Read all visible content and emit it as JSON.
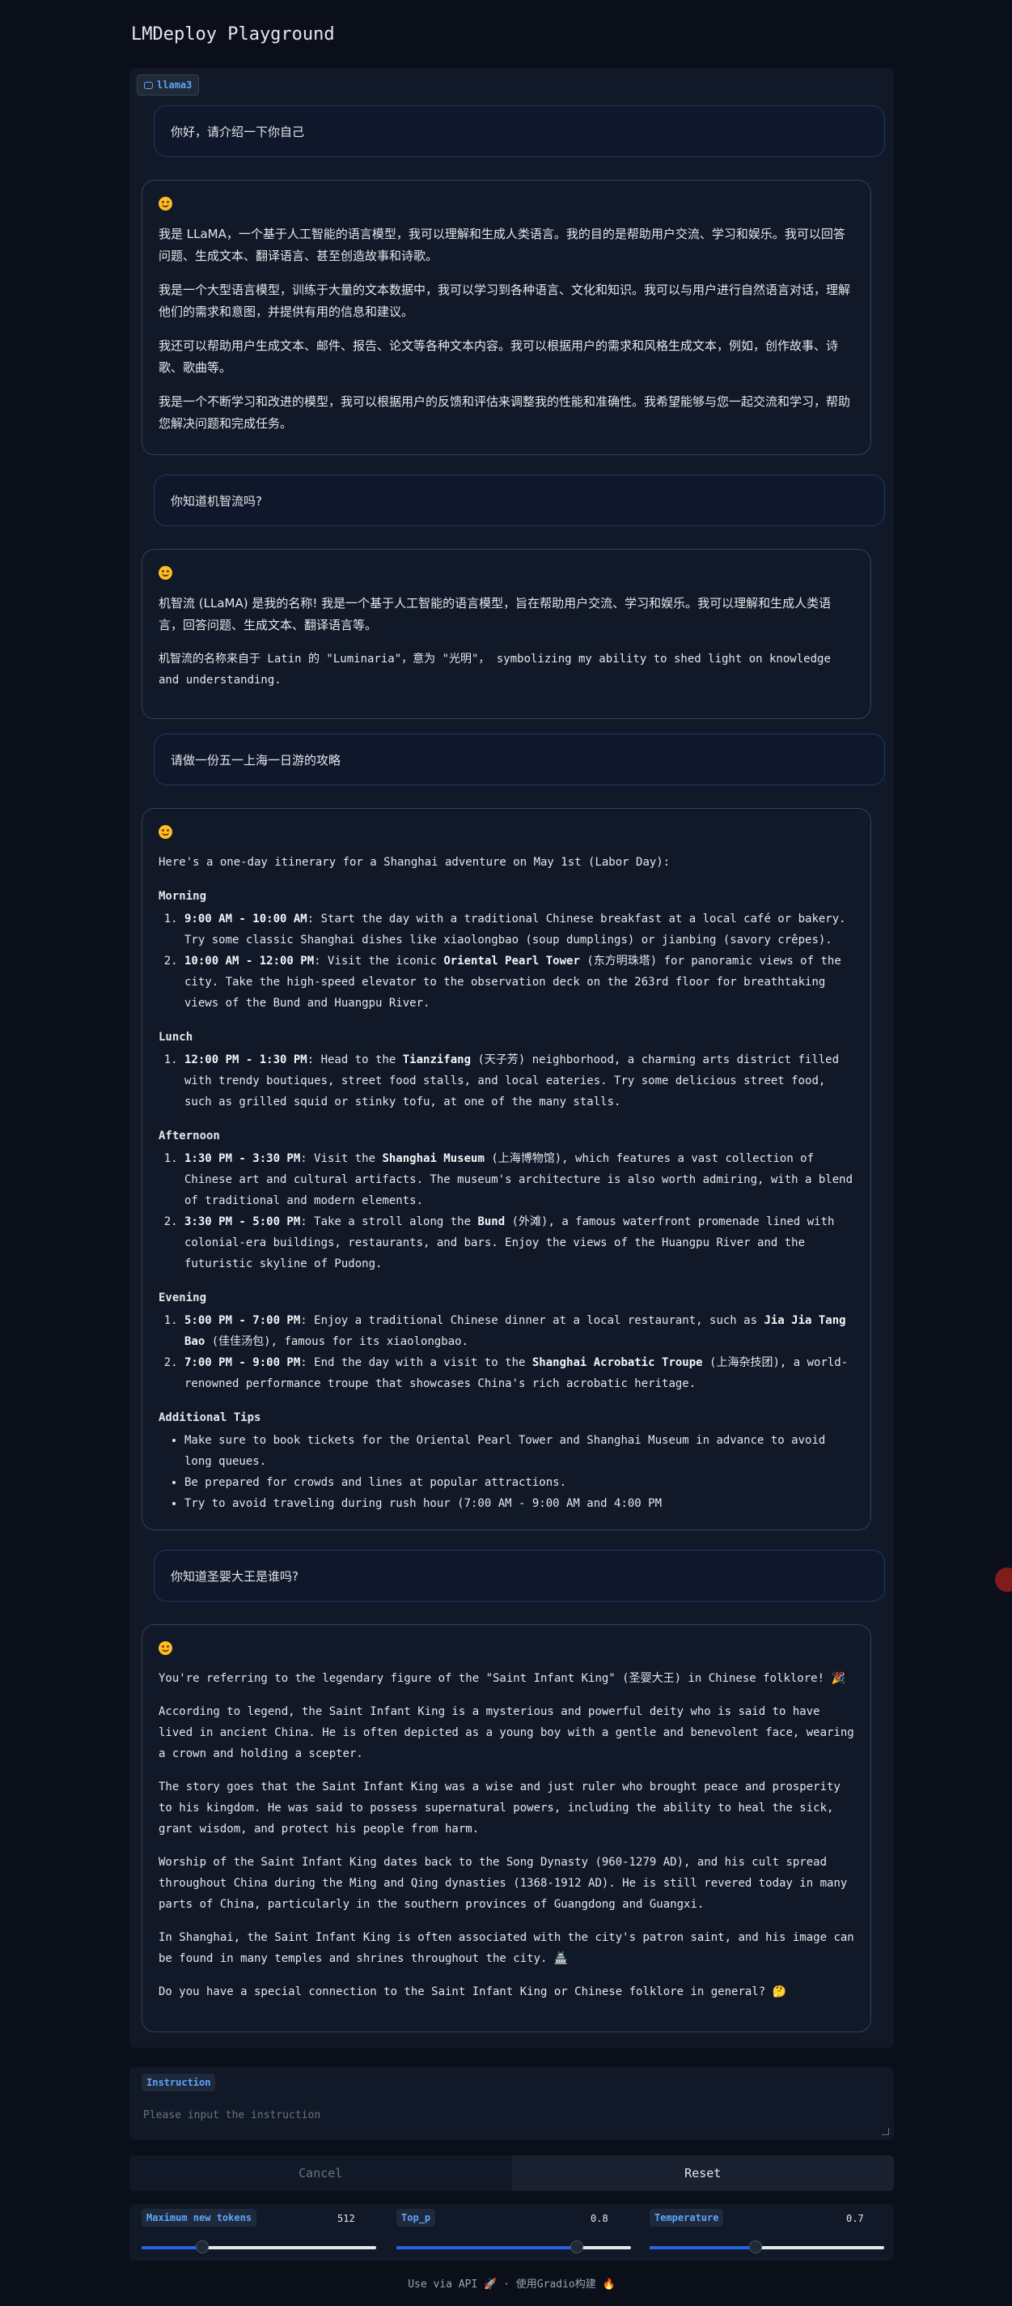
{
  "app": {
    "title": "LMDeploy Playground"
  },
  "chat": {
    "model_name": "llama3",
    "messages": [
      {
        "role": "user",
        "text": "你好，请介绍一下你自己"
      },
      {
        "role": "assistant",
        "paragraphs": [
          "我是 LLaMA，一个基于人工智能的语言模型，我可以理解和生成人类语言。我的目的是帮助用户交流、学习和娱乐。我可以回答问题、生成文本、翻译语言、甚至创造故事和诗歌。",
          "我是一个大型语言模型，训练于大量的文本数据中，我可以学习到各种语言、文化和知识。我可以与用户进行自然语言对话，理解他们的需求和意图，并提供有用的信息和建议。",
          "我还可以帮助用户生成文本、邮件、报告、论文等各种文本内容。我可以根据用户的需求和风格生成文本，例如，创作故事、诗歌、歌曲等。",
          "我是一个不断学习和改进的模型，我可以根据用户的反馈和评估来调整我的性能和准确性。我希望能够与您一起交流和学习，帮助您解决问题和完成任务。"
        ]
      },
      {
        "role": "user",
        "text": "你知道机智流吗?"
      },
      {
        "role": "assistant",
        "paragraphs": [
          "机智流 (LLaMA) 是我的名称! 我是一个基于人工智能的语言模型，旨在帮助用户交流、学习和娱乐。我可以理解和生成人类语言，回答问题、生成文本、翻译语言等。",
          "机智流的名称来自于 Latin 的 \"Luminaria\"，意为 \"光明\"， symbolizing my ability to shed light on knowledge and understanding."
        ]
      },
      {
        "role": "user",
        "text": "请做一份五一上海一日游的攻略"
      },
      {
        "role": "assistant",
        "intro": "Here's a one-day itinerary for a Shanghai adventure on May 1st (Labor Day):",
        "sections": [
          {
            "heading": "Morning",
            "items": [
              {
                "time": "9:00 AM - 10:00 AM",
                "text": ": Start the day with a traditional Chinese breakfast at a local café or bakery. Try some classic Shanghai dishes like xiaolongbao (soup dumplings) or jianbing (savory crêpes)."
              },
              {
                "time": "10:00 AM - 12:00 PM",
                "text_a": ": Visit the iconic ",
                "place": "Oriental Pearl Tower",
                "text_b": " (东方明珠塔) for panoramic views of the city. Take the high-speed elevator to the observation deck on the 263rd floor for breathtaking views of the Bund and Huangpu River."
              }
            ]
          },
          {
            "heading": "Lunch",
            "items": [
              {
                "time": "12:00 PM - 1:30 PM",
                "text_a": ": Head to the ",
                "place": "Tianzifang",
                "text_b": " (天子芳) neighborhood, a charming arts district filled with trendy boutiques, street food stalls, and local eateries. Try some delicious street food, such as grilled squid or stinky tofu, at one of the many stalls."
              }
            ]
          },
          {
            "heading": "Afternoon",
            "items": [
              {
                "time": "1:30 PM - 3:30 PM",
                "text_a": ": Visit the ",
                "place": "Shanghai Museum",
                "text_b": " (上海博物馆), which features a vast collection of Chinese art and cultural artifacts. The museum's architecture is also worth admiring, with a blend of traditional and modern elements."
              },
              {
                "time": "3:30 PM - 5:00 PM",
                "text_a": ": Take a stroll along the ",
                "place": "Bund",
                "text_b": " (外滩), a famous waterfront promenade lined with colonial-era buildings, restaurants, and bars. Enjoy the views of the Huangpu River and the futuristic skyline of Pudong."
              }
            ]
          },
          {
            "heading": "Evening",
            "items": [
              {
                "time": "5:00 PM - 7:00 PM",
                "text_a": ": Enjoy a traditional Chinese dinner at a local restaurant, such as ",
                "place": "Jia Jia Tang Bao",
                "text_b": " (佳佳汤包), famous for its xiaolongbao."
              },
              {
                "time": "7:00 PM - 9:00 PM",
                "text_a": ": End the day with a visit to the ",
                "place": "Shanghai Acrobatic Troupe",
                "text_b": " (上海杂技团), a world-renowned performance troupe that showcases China's rich acrobatic heritage."
              }
            ]
          }
        ],
        "tips_heading": "Additional Tips",
        "tips": [
          "Make sure to book tickets for the Oriental Pearl Tower and Shanghai Museum in advance to avoid long queues.",
          "Be prepared for crowds and lines at popular attractions.",
          "Try to avoid traveling during rush hour (7:00 AM - 9:00 AM and 4:00 PM"
        ]
      },
      {
        "role": "user",
        "text": "你知道圣婴大王是谁吗?"
      },
      {
        "role": "assistant",
        "paragraphs": [
          "You're referring to the legendary figure of the \"Saint Infant King\" (圣婴大王) in Chinese folklore! 🎉",
          "According to legend, the Saint Infant King is a mysterious and powerful deity who is said to have lived in ancient China. He is often depicted as a young boy with a gentle and benevolent face, wearing a crown and holding a scepter.",
          "The story goes that the Saint Infant King was a wise and just ruler who brought peace and prosperity to his kingdom. He was said to possess supernatural powers, including the ability to heal the sick, grant wisdom, and protect his people from harm.",
          "Worship of the Saint Infant King dates back to the Song Dynasty (960-1279 AD), and his cult spread throughout China during the Ming and Qing dynasties (1368-1912 AD). He is still revered today in many parts of China, particularly in the southern provinces of Guangdong and Guangxi.",
          "In Shanghai, the Saint Infant King is often associated with the city's patron saint, and his image can be found in many temples and shrines throughout the city. 🏯",
          "Do you have a special connection to the Saint Infant King or Chinese folklore in general? 🤔"
        ]
      }
    ]
  },
  "instruction": {
    "label": "Instruction",
    "placeholder": "Please input the instruction",
    "value": ""
  },
  "buttons": {
    "cancel": "Cancel",
    "reset": "Reset"
  },
  "params": {
    "max_new_tokens": {
      "label": "Maximum new tokens",
      "value": "512",
      "fraction": 0.26
    },
    "top_p": {
      "label": "Top_p",
      "value": "0.8",
      "fraction": 0.77
    },
    "temperature": {
      "label": "Temperature",
      "value": "0.7",
      "fraction": 0.45
    }
  },
  "footer": {
    "api_link": "Use via API 🚀",
    "separator": "·",
    "built_with": "使用Gradio构建 🔥"
  }
}
